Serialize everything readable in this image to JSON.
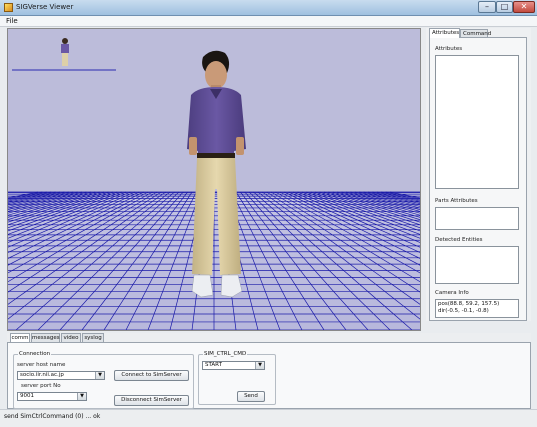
{
  "window": {
    "title": "SIGVerse Viewer",
    "icon": "sigverse-app-icon",
    "controls": {
      "minimize": "–",
      "maximize": "□",
      "close": "✕"
    }
  },
  "menu": {
    "file": "File"
  },
  "right_panel": {
    "tabs": [
      {
        "label": "Attributes",
        "active": true
      },
      {
        "label": "Command",
        "active": false
      }
    ],
    "attributes_label": "Attributes",
    "parts_attributes_label": "Parts Attributes",
    "detected_entities_label": "Detected Entities",
    "camera_info_label": "Camera Info",
    "camera_info_pos": "pos(88.8, 59.2, 157.5)",
    "camera_info_dir": "dir(-0.5, -0.1, -0.8)"
  },
  "bottom_tabs": [
    {
      "label": "comm",
      "active": true
    },
    {
      "label": "messages",
      "active": false
    },
    {
      "label": "video",
      "active": false
    },
    {
      "label": "syslog",
      "active": false
    }
  ],
  "connection": {
    "group_title": "Connection",
    "host_label": "server host name",
    "host_value": "socio.iir.nii.ac.jp",
    "port_label": "server port No",
    "port_value": "9001",
    "connect_button": "Connect to SimServer",
    "disconnect_button": "Disconnect SimServer"
  },
  "sim_ctrl": {
    "group_title": "SIM_CTRL_CMD",
    "selected": "START",
    "send_button": "Send"
  },
  "status": {
    "text": "send SimCtrlCommand (0) ... ok"
  },
  "colors": {
    "sky": "#bcbcda",
    "grid": "#1a1aa8",
    "shirt": "#5e4c94",
    "pants": "#d9c99c"
  }
}
